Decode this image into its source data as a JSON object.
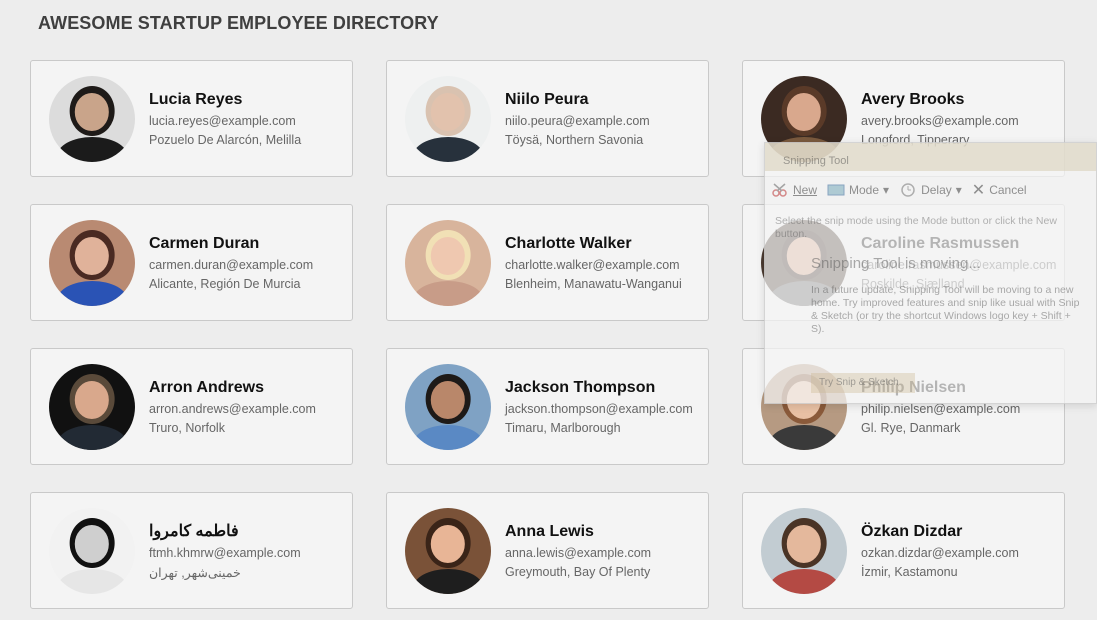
{
  "header": {
    "title": "AWESOME STARTUP EMPLOYEE DIRECTORY"
  },
  "employees": [
    {
      "name": "Lucia Reyes",
      "email": "lucia.reyes@example.com",
      "location": "Pozuelo De Alarcón, Melilla",
      "bg": "#dcdcdc",
      "hair": "#1e1a18",
      "skin": "#c9a48a",
      "shirt": "#1b1b1b"
    },
    {
      "name": "Niilo Peura",
      "email": "niilo.peura@example.com",
      "location": "Töysä, Northern Savonia",
      "bg": "#eef0f0",
      "hair": "#d9c2b0",
      "skin": "#e2c2ad",
      "shirt": "#27313c"
    },
    {
      "name": "Avery Brooks",
      "email": "avery.brooks@example.com",
      "location": "Longford, Tipperary",
      "bg": "#3b2a22",
      "hair": "#5a3a28",
      "skin": "#d9a88d",
      "shirt": "#7a5a3e"
    },
    {
      "name": "Carmen Duran",
      "email": "carmen.duran@example.com",
      "location": "Alicante, Región De Murcia",
      "bg": "#b98a72",
      "hair": "#4a2a22",
      "skin": "#e0b29a",
      "shirt": "#2a53b5"
    },
    {
      "name": "Charlotte Walker",
      "email": "charlotte.walker@example.com",
      "location": "Blenheim, Manawatu-Wanganui",
      "bg": "#d8b49c",
      "hair": "#f1e0b5",
      "skin": "#efc8b0",
      "shirt": "#c89c88"
    },
    {
      "name": "Caroline Rasmussen",
      "email": "caroline.rasmussen@example.com",
      "location": "Roskilde, Sjælland",
      "bg": "#4a3a30",
      "hair": "#3a2a22",
      "skin": "#d9aa8e",
      "shirt": "#6a6a6a"
    },
    {
      "name": "Arron Andrews",
      "email": "arron.andrews@example.com",
      "location": "Truro, Norfolk",
      "bg": "#111111",
      "hair": "#5a4a3a",
      "skin": "#d9a88c",
      "shirt": "#222a34"
    },
    {
      "name": "Jackson Thompson",
      "email": "jackson.thompson@example.com",
      "location": "Timaru, Marlborough",
      "bg": "#7fa2c4",
      "hair": "#1e1a18",
      "skin": "#b9876a",
      "shirt": "#5a89c4"
    },
    {
      "name": "Philip Nielsen",
      "email": "philip.nielsen@example.com",
      "location": "Gl. Rye, Danmark",
      "bg": "#b69a82",
      "hair": "#8a5a3a",
      "skin": "#e8c0a4",
      "shirt": "#3a3a3a"
    },
    {
      "name": "فاطمه کامروا",
      "email": "ftmh.khmrw@example.com",
      "location": "خمینی‌شهر, تهران",
      "bg": "#f2f2f2",
      "hair": "#111111",
      "skin": "#cfcfcf",
      "shirt": "#e6e6e6"
    },
    {
      "name": "Anna Lewis",
      "email": "anna.lewis@example.com",
      "location": "Greymouth, Bay Of Plenty",
      "bg": "#7a5238",
      "hair": "#3a2418",
      "skin": "#e8b596",
      "shirt": "#1e1e1e"
    },
    {
      "name": "Özkan Dizdar",
      "email": "ozkan.dizdar@example.com",
      "location": "İzmir, Kastamonu",
      "bg": "#c2ccd2",
      "hair": "#4a3426",
      "skin": "#e4b89c",
      "shirt": "#b44a44"
    }
  ],
  "snipping_tool": {
    "title": "Snipping Tool",
    "new_label": "New",
    "mode_label": "Mode",
    "delay_label": "Delay",
    "cancel_label": "Cancel",
    "hint": "Select the snip mode using the Mode button or click the New button.",
    "moving_title": "Snipping Tool is moving...",
    "moving_body": "In a future update, Snipping Tool will be moving to a new home. Try improved features and snip like usual with Snip & Sketch (or try the shortcut Windows logo key + Shift + S).",
    "try_button": "Try Snip & Sketch"
  }
}
